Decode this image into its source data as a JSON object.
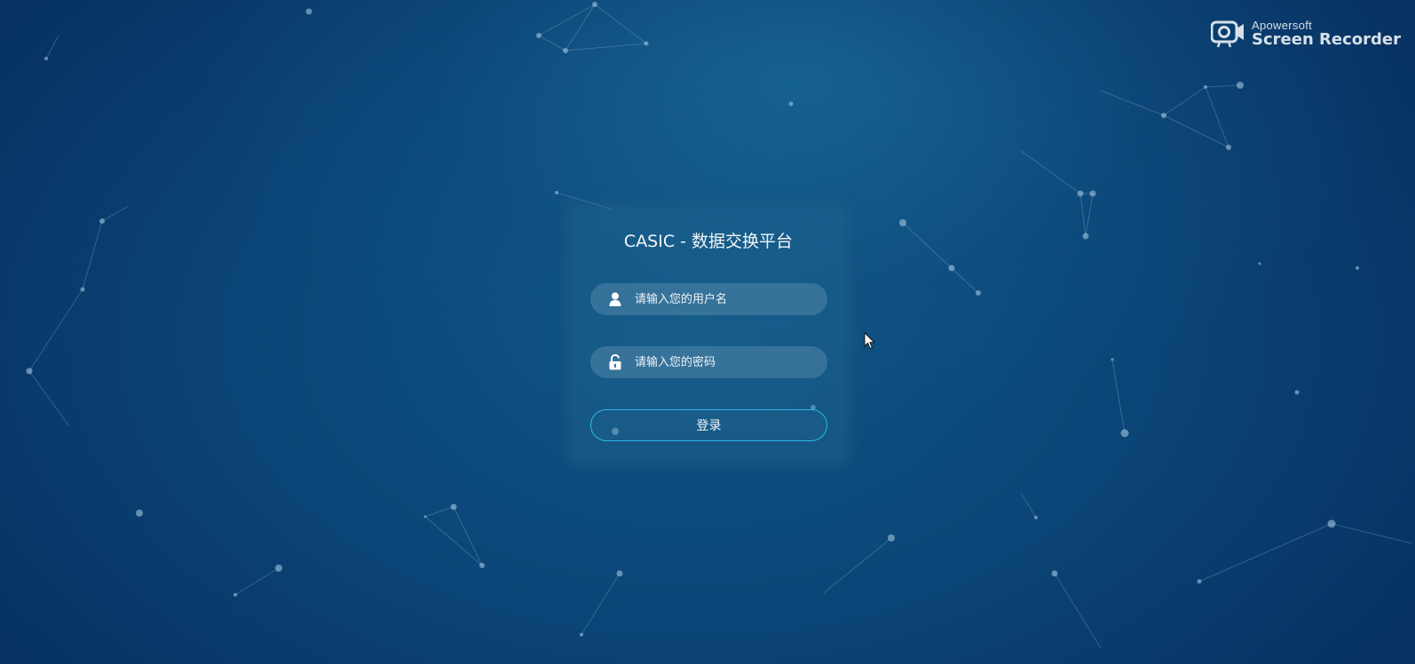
{
  "watermark": {
    "brand_top": "Apowersoft",
    "brand_bottom": "Screen Recorder",
    "icon": "camera-recorder-icon"
  },
  "login": {
    "title": "CASIC - 数据交换平台",
    "username_placeholder": "请输入您的用户名",
    "username_icon": "user-icon",
    "password_placeholder": "请输入您的密码",
    "password_icon": "unlock-icon",
    "submit_label": "登录"
  },
  "colors": {
    "background_dark": "#083566",
    "background_mid": "#0f5685",
    "button_border": "#2cb7e3",
    "text": "#f3f6f8"
  }
}
